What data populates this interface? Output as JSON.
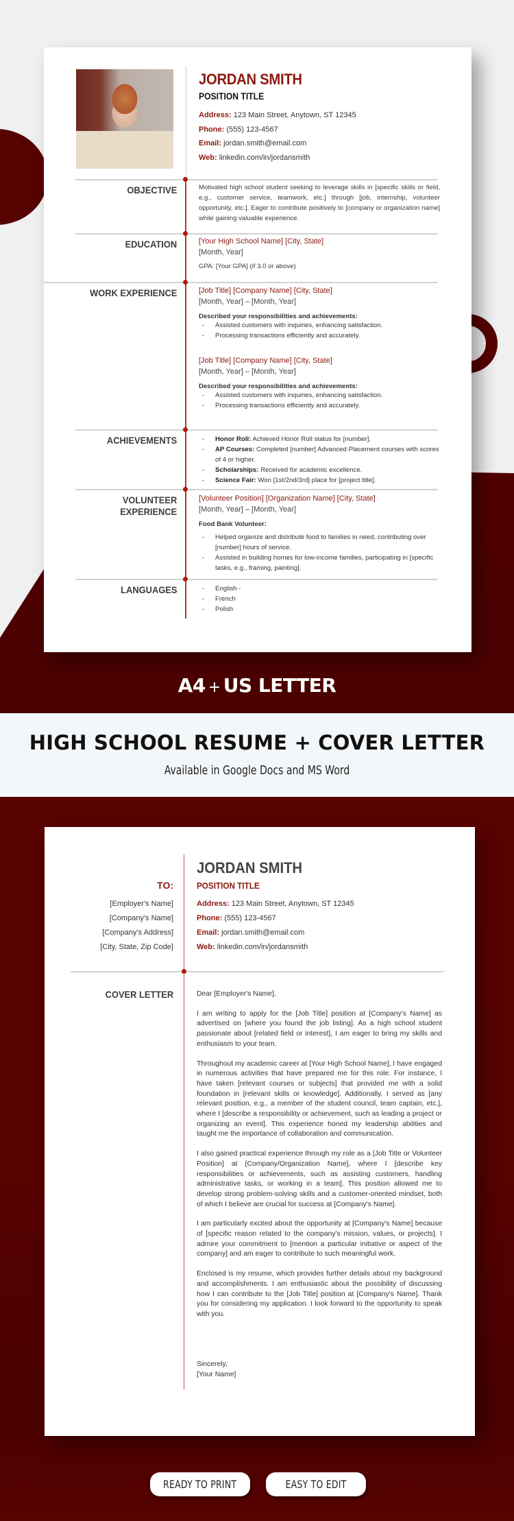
{
  "colors": {
    "accent": "#8b1a10",
    "brand_dark_red": "#560200",
    "timeline_red": "#b03a2e",
    "background_light": "#f0f0f0"
  },
  "resume": {
    "name": "JORDAN SMITH",
    "position_title": "POSITION TITLE",
    "photo_icon": "profile-photo",
    "contact": [
      {
        "label": "Address:",
        "value": "123 Main Street, Anytown, ST 12345"
      },
      {
        "label": "Phone:",
        "value": "(555) 123-4567"
      },
      {
        "label": "Email:",
        "value": "jordan.smith@email.com"
      },
      {
        "label": "Web:",
        "value": "linkedin.com/in/jordansmith"
      }
    ],
    "objective": {
      "heading": "OBJECTIVE",
      "text": "Motivated high school student seeking to leverage skills in [specific skills or field, e.g., customer service, teamwork, etc.] through [job, internship, volunteer opportunity, etc.]. Eager to contribute positively to [company or organization name] while gaining valuable experience."
    },
    "education": {
      "heading": "EDUCATION",
      "school": "[Your High School Name]  [City, State]",
      "date": "[Month, Year]",
      "gpa": "GPA: [Your GPA] (if 3.0 or above)"
    },
    "work_experience": {
      "heading": "WORK EXPERIENCE",
      "jobs": [
        {
          "title": "[Job Title] [Company Name]  [City, State]",
          "dates": "[Month, Year] – [Month, Year]",
          "subheading": "Described your responsibilities and achievements:",
          "bullets": [
            "Assisted customers with inquiries, enhancing satisfaction.",
            "Processing transactions efficiently and accurately."
          ]
        },
        {
          "title": "[Job Title] [Company Name]  [City, State]",
          "dates": "[Month, Year] – [Month, Year]",
          "subheading": "Described your responsibilities and achievements:",
          "bullets": [
            "Assisted customers with inquiries, enhancing satisfaction.",
            "Processing transactions efficiently and accurately."
          ]
        }
      ]
    },
    "achievements": {
      "heading": "ACHIEVEMENTS",
      "items": [
        {
          "bold": "Honor Roll:",
          "text": " Achieved Honor Roll status for [number]."
        },
        {
          "bold": "AP Courses:",
          "text": " Completed [number] Advanced Placement courses with scores of 4 or higher."
        },
        {
          "bold": "Scholarships:",
          "text": " Received for academic excellence."
        },
        {
          "bold": "Science Fair:",
          "text": " Won [1st/2nd/3rd] place for [project title]."
        }
      ]
    },
    "volunteer": {
      "heading_line1": "VOLUNTEER",
      "heading_line2": "EXPERIENCE",
      "title": "[Volunteer Position] [Organization Name]  [City, State]",
      "dates": "[Month, Year] – [Month, Year]",
      "subheading": "Food Bank Volunteer:",
      "bullets": [
        "Helped organize and distribute food to families in need, contributing over [number] hours of service.",
        "Assisted in building homes for low-income families, participating in [specific tasks, e.g., framing, painting]."
      ]
    },
    "languages": {
      "heading": "LANGUAGES",
      "items": [
        "English -",
        "French",
        "Polish"
      ]
    },
    "bullet_dash": "-"
  },
  "banner": {
    "format_left": "A4",
    "format_plus": "+",
    "format_right": "US LETTER",
    "title": "HIGH SCHOOL RESUME + COVER LETTER",
    "subtitle": "Available in Google Docs and MS Word"
  },
  "cover_letter": {
    "to_label": "TO:",
    "recipient": [
      "[Employer's Name]",
      "[Company's Name]",
      "[Company's Address]",
      "[City, State, Zip Code]"
    ],
    "name": "JORDAN SMITH",
    "position_title": "POSITION TITLE",
    "contact": [
      {
        "label": "Address:",
        "value": "123 Main Street, Anytown, ST 12345"
      },
      {
        "label": "Phone:",
        "value": "(555) 123-4567"
      },
      {
        "label": "Email:",
        "value": "jordan.smith@email.com"
      },
      {
        "label": "Web:",
        "value": "linkedin.com/in/jordansmith"
      }
    ],
    "section_heading": "COVER LETTER",
    "salutation": "Dear [Employer's Name],",
    "paragraphs": [
      "I am writing to apply for the [Job Title] position at [Company's Name] as advertised on [where you found the job listing]. As a high school student passionate about [related field or interest], I am eager to bring my skills and enthusiasm to your team.",
      "Throughout my academic career at [Your High School Name], I have engaged in numerous activities that have prepared me for this role. For instance, I have taken [relevant courses or subjects] that provided me with a solid foundation in [relevant skills or knowledge]. Additionally, I served as [any relevant position, e.g., a member of the student council, team captain, etc.], where I [describe a responsibility or achievement, such as leading a project or organizing an event]. This experience honed my leadership abilities and taught me the importance of collaboration and communication.",
      "I also gained practical experience through my role as a [Job Title or Volunteer Position] at [Company/Organization Name], where I [describe key responsibilities or achievements, such as assisting customers, handling administrative tasks, or working in a team]. This position allowed me to develop strong problem-solving skills and a customer-oriented mindset, both of which I believe are crucial for success at [Company's Name].",
      "I am particularly excited about the opportunity at [Company's Name] because of [specific reason related to the company's mission, values, or projects]. I admire your commitment to [mention a particular initiative or aspect of the company] and am eager to contribute to such meaningful work.",
      "Enclosed is my resume, which provides further details about my background and accomplishments. I am enthusiastic about the possibility of discussing how I can contribute to the [Job Title] position at [Company's Name]. Thank you for considering my application. I look forward to the opportunity to speak with you."
    ],
    "closing": "Sincerely,",
    "signature": "[Your Name]"
  },
  "badges": [
    "READY TO PRINT",
    "EASY TO EDIT"
  ]
}
